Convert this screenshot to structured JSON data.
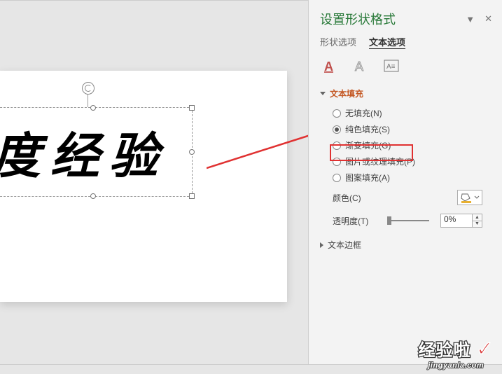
{
  "panel": {
    "title": "设置形状格式",
    "tabs": {
      "shape": "形状选项",
      "text": "文本选项"
    },
    "sections": {
      "text_fill": {
        "title": "文本填充",
        "options": {
          "no_fill": "无填充(N)",
          "solid_fill": "纯色填充(S)",
          "gradient_fill": "渐变填充(G)",
          "picture_fill": "图片或纹理填充(P)",
          "pattern_fill": "图案填充(A)"
        },
        "color_label": "颜色(C)",
        "transparency_label": "透明度(T)",
        "transparency_value": "0%"
      },
      "text_border": {
        "title": "文本边框"
      }
    }
  },
  "slide": {
    "text": "度经验"
  },
  "watermark": {
    "main": "经验啦",
    "sub": "jingyanla.com"
  }
}
